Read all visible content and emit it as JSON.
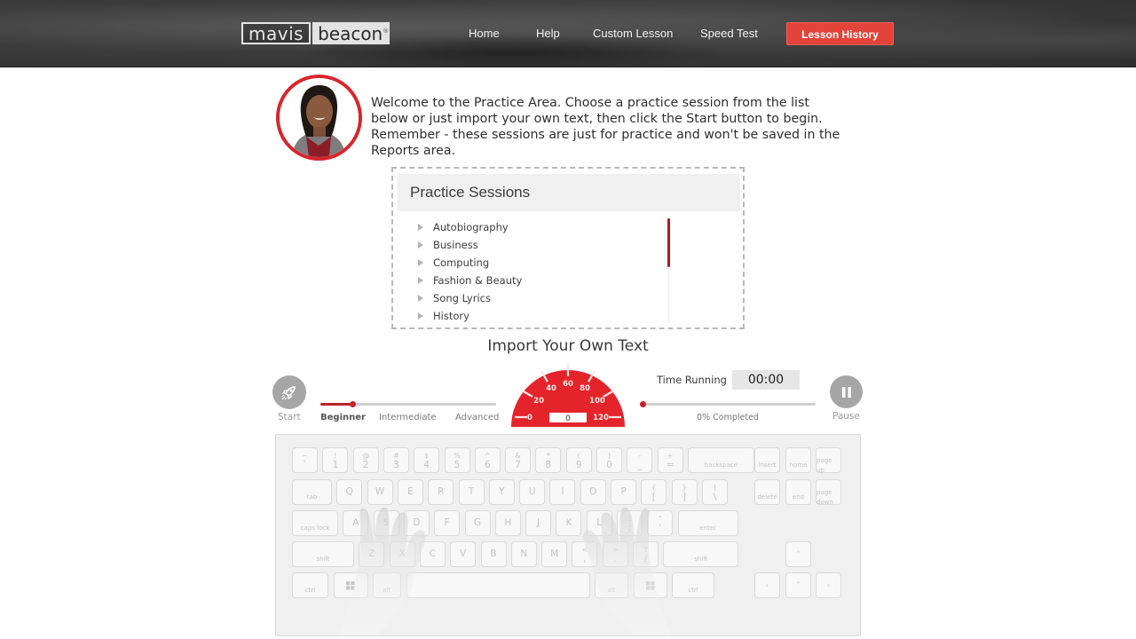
{
  "header": {
    "logo": {
      "part1": "mavis",
      "part2": "beacon",
      "reg": "®"
    },
    "nav": [
      {
        "label": "Home"
      },
      {
        "label": "Help"
      },
      {
        "label": "Custom Lesson"
      },
      {
        "label": "Speed Test"
      }
    ],
    "active_button": {
      "label": "Lesson History",
      "color": "#e2443a"
    }
  },
  "welcome": {
    "avatar_icon": "instructor-portrait",
    "text": "Welcome to the Practice Area. Choose a practice session from the list below or just import your own text, then click the Start button to begin. Remember - these sessions are just for practice and won't be saved in the Reports area."
  },
  "practice_sessions": {
    "title": "Practice Sessions",
    "items": [
      {
        "label": "Autobiography"
      },
      {
        "label": "Business"
      },
      {
        "label": "Computing"
      },
      {
        "label": "Fashion & Beauty"
      },
      {
        "label": "Song Lyrics"
      },
      {
        "label": "History"
      }
    ],
    "scroll_position": 0
  },
  "import": {
    "title": "Import Your Own Text"
  },
  "controls": {
    "start": {
      "label": "Start",
      "icon": "rocket-icon"
    },
    "pause": {
      "label": "Pause",
      "icon": "pause-icon"
    },
    "levels": [
      "Beginner",
      "Intermediate",
      "Advanced"
    ],
    "selected_level": "Beginner",
    "level_slider_value": 0.18,
    "speedometer": {
      "ticks": [
        "0",
        "20",
        "40",
        "60",
        "80",
        "100",
        "120"
      ],
      "value": "0",
      "color": "#e4242b"
    },
    "time_running": {
      "label": "Time Running",
      "value": "00:00"
    },
    "progress": {
      "label": "0% Completed",
      "value": 0
    }
  },
  "keyboard": {
    "row1": [
      {
        "top": "~",
        "bottom": "`"
      },
      {
        "top": "!",
        "bottom": "1"
      },
      {
        "top": "@",
        "bottom": "2"
      },
      {
        "top": "#",
        "bottom": "3"
      },
      {
        "top": "$",
        "bottom": "4"
      },
      {
        "top": "%",
        "bottom": "5"
      },
      {
        "top": "^",
        "bottom": "6"
      },
      {
        "top": "&",
        "bottom": "7"
      },
      {
        "top": "*",
        "bottom": "8"
      },
      {
        "top": "(",
        "bottom": "9"
      },
      {
        "top": ")",
        "bottom": "0"
      },
      {
        "top": "-",
        "bottom": "_"
      },
      {
        "top": "+",
        "bottom": "="
      },
      {
        "word": "backspace"
      }
    ],
    "row2": [
      {
        "word": "tab"
      },
      {
        "letter": "Q"
      },
      {
        "letter": "W"
      },
      {
        "letter": "E"
      },
      {
        "letter": "R"
      },
      {
        "letter": "T"
      },
      {
        "letter": "Y"
      },
      {
        "letter": "U"
      },
      {
        "letter": "I"
      },
      {
        "letter": "O"
      },
      {
        "letter": "P"
      },
      {
        "top": "{",
        "bottom": "["
      },
      {
        "top": "}",
        "bottom": "]"
      },
      {
        "top": "|",
        "bottom": "\\"
      }
    ],
    "row3": [
      {
        "word": "caps lock"
      },
      {
        "letter": "A"
      },
      {
        "letter": "S"
      },
      {
        "letter": "D"
      },
      {
        "letter": "F"
      },
      {
        "letter": "G"
      },
      {
        "letter": "H"
      },
      {
        "letter": "J"
      },
      {
        "letter": "K"
      },
      {
        "letter": "L"
      },
      {
        "top": ":",
        "bottom": ";"
      },
      {
        "top": "\"",
        "bottom": "'"
      },
      {
        "word": "enter"
      }
    ],
    "row4": [
      {
        "word": "shift"
      },
      {
        "letter": "Z"
      },
      {
        "letter": "X"
      },
      {
        "letter": "C"
      },
      {
        "letter": "V"
      },
      {
        "letter": "B"
      },
      {
        "letter": "N"
      },
      {
        "letter": "M"
      },
      {
        "top": "<",
        "bottom": ","
      },
      {
        "top": ">",
        "bottom": "."
      },
      {
        "top": "?",
        "bottom": "/"
      },
      {
        "word": "shift"
      }
    ],
    "row5": [
      {
        "word": "ctrl"
      },
      {
        "icon": "windows-icon"
      },
      {
        "word": "alt"
      },
      {
        "word": ""
      },
      {
        "word": "alt"
      },
      {
        "icon": "windows-icon"
      },
      {
        "word": "ctrl"
      }
    ],
    "nav_keys": [
      {
        "word": "insert"
      },
      {
        "word": "home"
      },
      {
        "word": "page up"
      },
      {
        "word": "delete"
      },
      {
        "word": "end"
      },
      {
        "word": "page down"
      }
    ],
    "arrows": [
      {
        "glyph": "˄"
      },
      {
        "glyph": "‹"
      },
      {
        "glyph": "˅"
      },
      {
        "glyph": "›"
      }
    ]
  }
}
